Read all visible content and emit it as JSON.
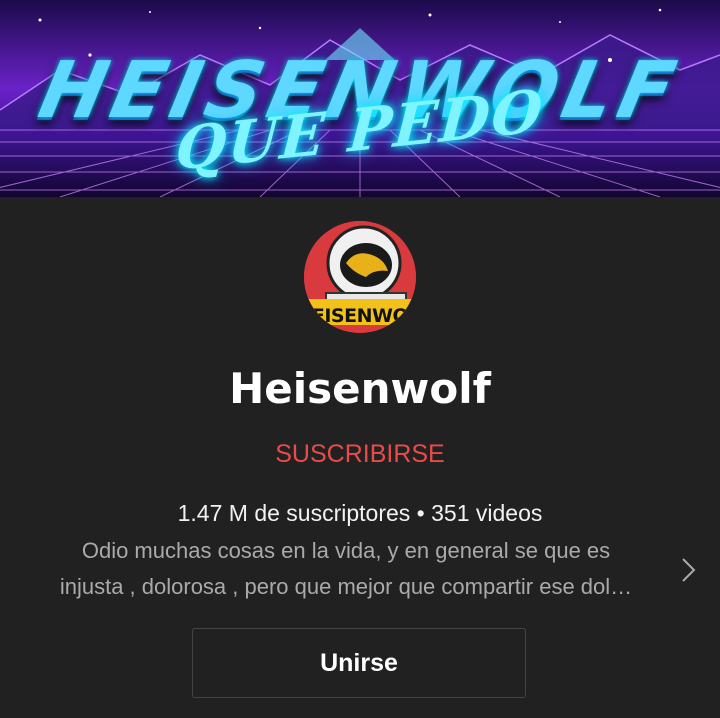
{
  "banner": {
    "title": "HEISENWOLF",
    "subtitle": "QUE PEDO"
  },
  "channel": {
    "avatar_text": "EISENWO",
    "name": "Heisenwolf",
    "subscribe_label": "SUSCRIBIRSE",
    "stats": "1.47 M de suscriptores • 351 videos",
    "description_line1": "Odio muchas cosas en la vida, y en general se que es",
    "description_line2": "injusta , dolorosa , pero que mejor que compartir ese dol…",
    "join_label": "Unirse"
  },
  "icons": {
    "description_expand": "chevron-right-icon"
  },
  "colors": {
    "background": "#212121",
    "subscribe": "#e94a4a",
    "secondary_text": "#aaaaaa",
    "banner_glow": "#00e1ff"
  }
}
